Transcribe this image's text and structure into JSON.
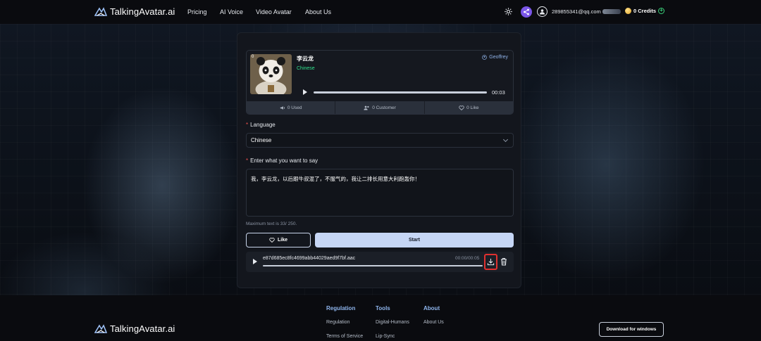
{
  "header": {
    "logo_text": "TalkingAvatar.ai",
    "nav": [
      "Pricing",
      "AI Voice",
      "Video Avatar",
      "About Us"
    ],
    "email": "289855341@qq.com",
    "credits": "0 Credits"
  },
  "voice": {
    "badge": "0",
    "name": "李云龙",
    "language": "Chinese",
    "author": "Geoffrey",
    "duration": "00:03",
    "stats": {
      "used": "0 Used",
      "customer": "0 Customer",
      "like": "0 Like"
    }
  },
  "form": {
    "language_label": "Language",
    "language_value": "Chinese",
    "text_label": "Enter what you want to say",
    "text_value": "我，李云龙，以后跟牛叔混了，不服气的，我让二排长用意大利跑轰你！",
    "hint": "Maximum text is 33/ 250.",
    "like_label": "Like",
    "start_label": "Start"
  },
  "result": {
    "filename": "e87d685ec8fc4699abb44029aed9f7bf.aac",
    "time": "00:00/00:05"
  },
  "footer": {
    "logo_text": "TalkingAvatar.ai",
    "columns": [
      {
        "title": "Regulation",
        "links": [
          "Regulation",
          "Terms of Service"
        ]
      },
      {
        "title": "Tools",
        "links": [
          "Digital-Humans",
          "Lip-Sync"
        ]
      },
      {
        "title": "About",
        "links": [
          "About Us"
        ]
      }
    ],
    "download_label": "Download for windows"
  },
  "colors": {
    "accent_green": "#2fe08c",
    "accent_blue": "#8fb6ee",
    "start_button": "#c6d6f5",
    "highlight_red": "#e0302f"
  }
}
